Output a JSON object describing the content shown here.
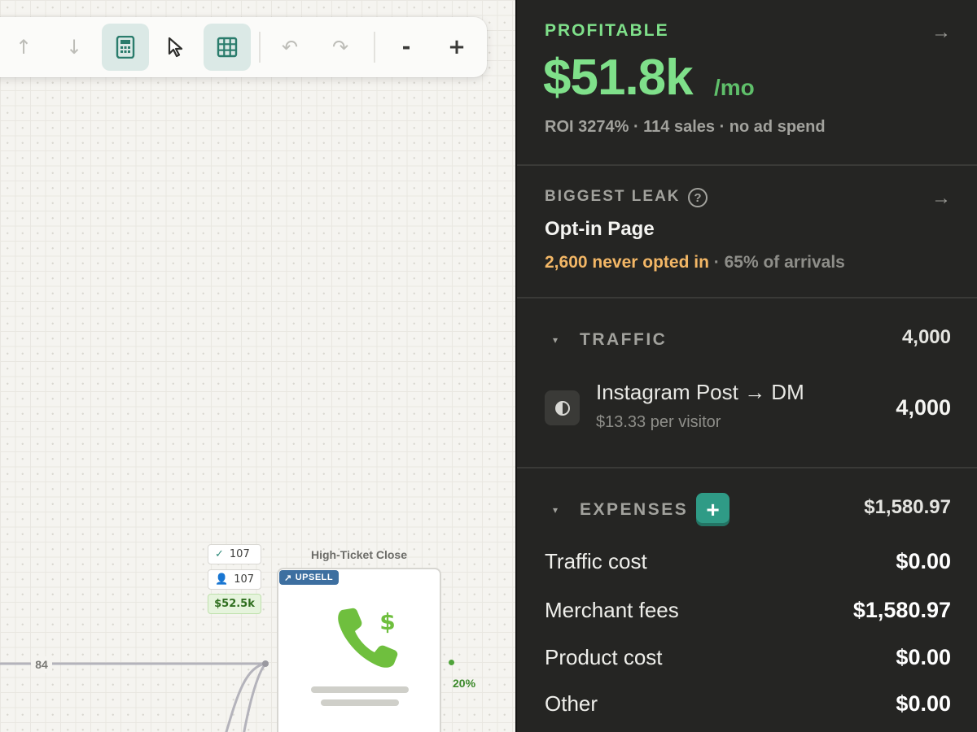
{
  "toolbar": {
    "buttons": [
      {
        "icon": "arrow-up-icon",
        "glyph": "↑"
      },
      {
        "icon": "arrow-down-icon",
        "glyph": "↓"
      },
      {
        "icon": "calculator-icon",
        "glyph": ""
      },
      {
        "icon": "pointer-icon",
        "glyph": ""
      },
      {
        "icon": "grid-icon",
        "glyph": ""
      },
      {
        "icon": "undo-icon",
        "glyph": "↶"
      },
      {
        "icon": "redo-icon",
        "glyph": "↷"
      },
      {
        "icon": "zoom-out-icon",
        "glyph": "-"
      },
      {
        "icon": "zoom-in-icon",
        "glyph": "+"
      }
    ]
  },
  "canvas": {
    "stats": {
      "checked": "107",
      "people": "107",
      "revenue": "$52.5k"
    },
    "node": {
      "title": "High-Ticket Close",
      "badge": "UPSELL",
      "badge_icon": "↗",
      "icon": "phone-dollar-icon"
    },
    "edge_count": "84",
    "edge_percent": "20%"
  },
  "panel": {
    "profit": {
      "label": "PROFITABLE",
      "value": "$51.8k",
      "unit": "/mo",
      "subtitle": "ROI 3274% · 114 sales · no ad spend",
      "arrow": "→"
    },
    "leak": {
      "label": "BIGGEST LEAK",
      "help": "?",
      "name": "Opt-in Page",
      "highlight": "2,600 never opted in",
      "detail": " · 65% of arrivals",
      "arrow": "→"
    },
    "traffic": {
      "caret": "▾",
      "label": "TRAFFIC",
      "total": "4,000",
      "source": {
        "name": "Instagram Post → DM",
        "sub": "$13.33 per visitor",
        "value": "4,000",
        "icon": "half-circle-icon"
      }
    },
    "expenses": {
      "caret": "▾",
      "label": "EXPENSES",
      "add": "+",
      "total": "$1,580.97",
      "rows": [
        {
          "name": "Traffic cost",
          "amount": "$0.00"
        },
        {
          "name": "Merchant fees",
          "amount": "$1,580.97"
        },
        {
          "name": "Product cost",
          "amount": "$0.00"
        },
        {
          "name": "Other",
          "amount": "$0.00"
        }
      ]
    }
  },
  "colors": {
    "accent_green": "#7fe08a",
    "teal": "#2f9b86",
    "warning": "#f3b766",
    "panel_bg": "#252523"
  }
}
